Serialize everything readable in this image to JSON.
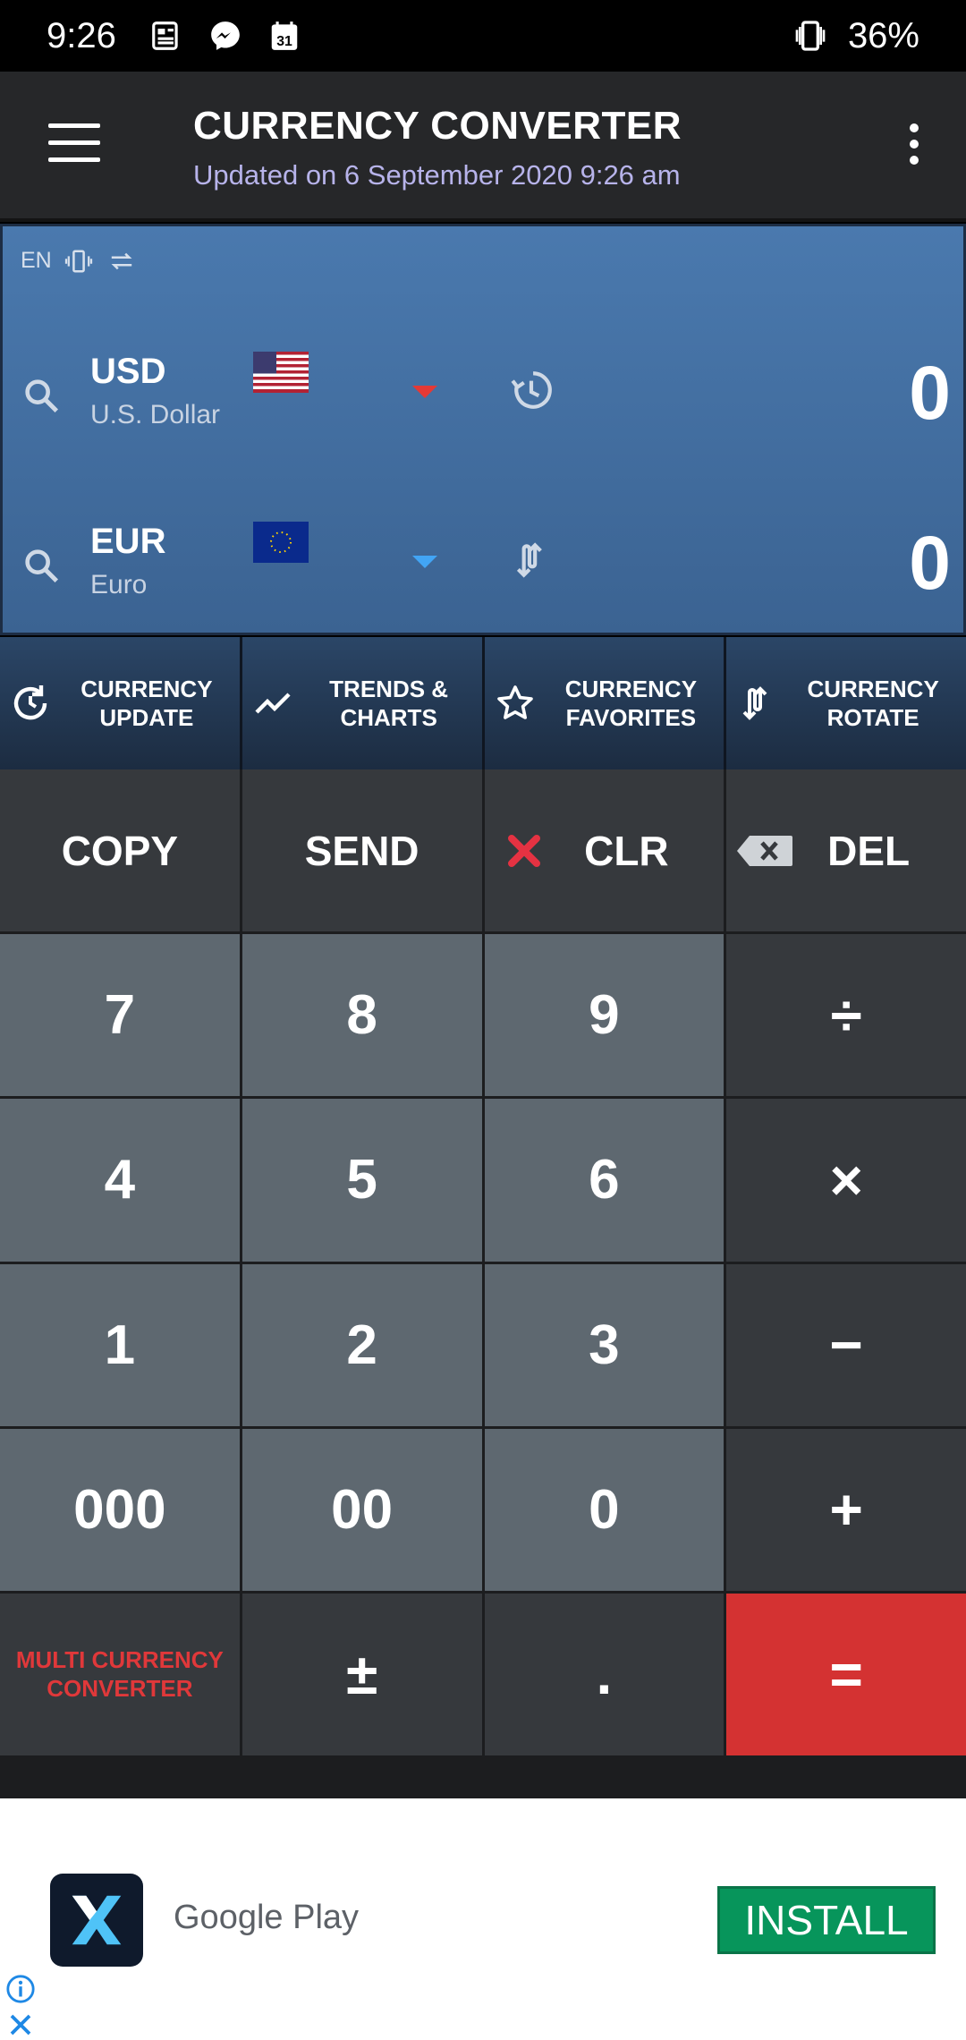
{
  "status_bar": {
    "time": "9:26",
    "battery": "36%",
    "icons": [
      "news-icon",
      "messenger-icon",
      "calendar-icon",
      "vibrate-icon"
    ],
    "calendar_day": "31"
  },
  "app_bar": {
    "title": "CURRENCY CONVERTER",
    "subtitle": "Updated on 6 September 2020 9:26 am"
  },
  "converter": {
    "lang": "EN",
    "from": {
      "code": "USD",
      "name": "U.S. Dollar",
      "value": "0",
      "caret_color": "#e53935"
    },
    "to": {
      "code": "EUR",
      "name": "Euro",
      "value": "0",
      "caret_color": "#42a5f5"
    }
  },
  "toolbar": {
    "items": [
      {
        "line1": "CURRENCY",
        "line2": "UPDATE",
        "icon": "refresh-icon"
      },
      {
        "line1": "TRENDS &",
        "line2": "CHARTS",
        "icon": "trend-icon"
      },
      {
        "line1": "CURRENCY",
        "line2": "FAVORITES",
        "icon": "star-icon"
      },
      {
        "line1": "CURRENCY",
        "line2": "ROTATE",
        "icon": "rotate-icon"
      }
    ]
  },
  "keypad": {
    "copy": "COPY",
    "send": "SEND",
    "clr": "CLR",
    "del": "DEL",
    "k7": "7",
    "k8": "8",
    "k9": "9",
    "divide": "÷",
    "k4": "4",
    "k5": "5",
    "k6": "6",
    "multiply": "×",
    "k1": "1",
    "k2": "2",
    "k3": "3",
    "minus": "−",
    "k000": "000",
    "k00": "00",
    "k0": "0",
    "plus": "+",
    "multi_line1": "MULTI CURRENCY",
    "multi_line2": "CONVERTER",
    "plusminus": "±",
    "dot": ".",
    "equals": "="
  },
  "ad": {
    "brand": "Google Play",
    "install": "INSTALL"
  },
  "colors": {
    "accent_red": "#d43232",
    "install_green": "#07955b",
    "subtitle": "#b7b3ea"
  }
}
